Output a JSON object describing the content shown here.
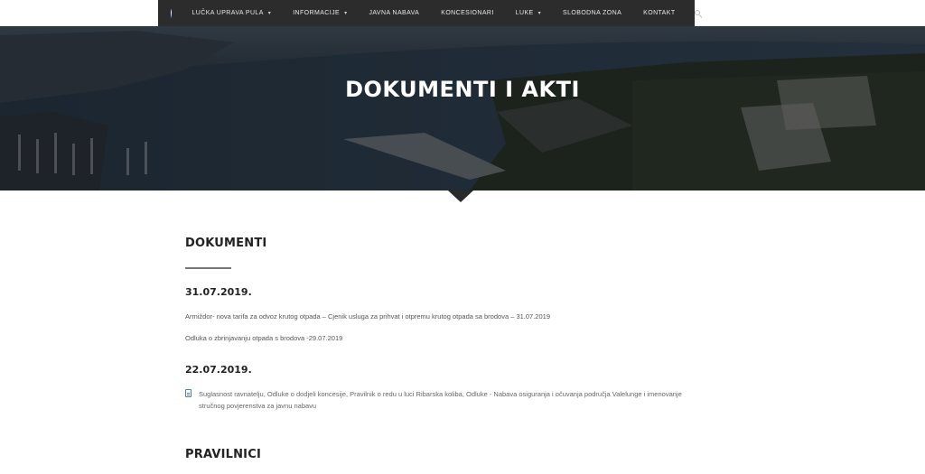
{
  "nav": {
    "items": [
      {
        "label": "LUČKA UPRAVA PULA",
        "has_caret": true
      },
      {
        "label": "INFORMACIJE",
        "has_caret": true
      },
      {
        "label": "JAVNA NABAVA",
        "has_caret": false
      },
      {
        "label": "KONCESIONARI",
        "has_caret": false
      },
      {
        "label": "LUKE",
        "has_caret": true
      },
      {
        "label": "SLOBODNA ZONA",
        "has_caret": false
      },
      {
        "label": "KONTAKT",
        "has_caret": false
      }
    ],
    "caret": "▾"
  },
  "hero": {
    "title": "DOKUMENTI I AKTI"
  },
  "content": {
    "section1_title": "DOKUMENTI",
    "groups": [
      {
        "date": "31.07.2019.",
        "docs": [
          "Armiždor- nova tarifa za odvoz krutog otpada – Cjenik usluga za prihvat i otpremu krutog otpada sa brodova – 31.07.2019",
          "Odluka o zbrinjavanju otpada s brodova  -29.07.2019"
        ]
      },
      {
        "date": "22.07.2019.",
        "docs": [
          "Suglasnost ravnatelju, Odluke o dodjeli koncesije, Pravilnik o redu u luci Ribarska koliba, Odluke - Nabava osiguranja i očuvanja područja Valelunge i imenovanje stručnog povjerenstva za javnu nabavu"
        ]
      }
    ],
    "section2_title": "PRAVILNICI"
  },
  "colors": {
    "nav_bg": "#2c2c2c",
    "accent_icon": "#4a7fc4"
  }
}
